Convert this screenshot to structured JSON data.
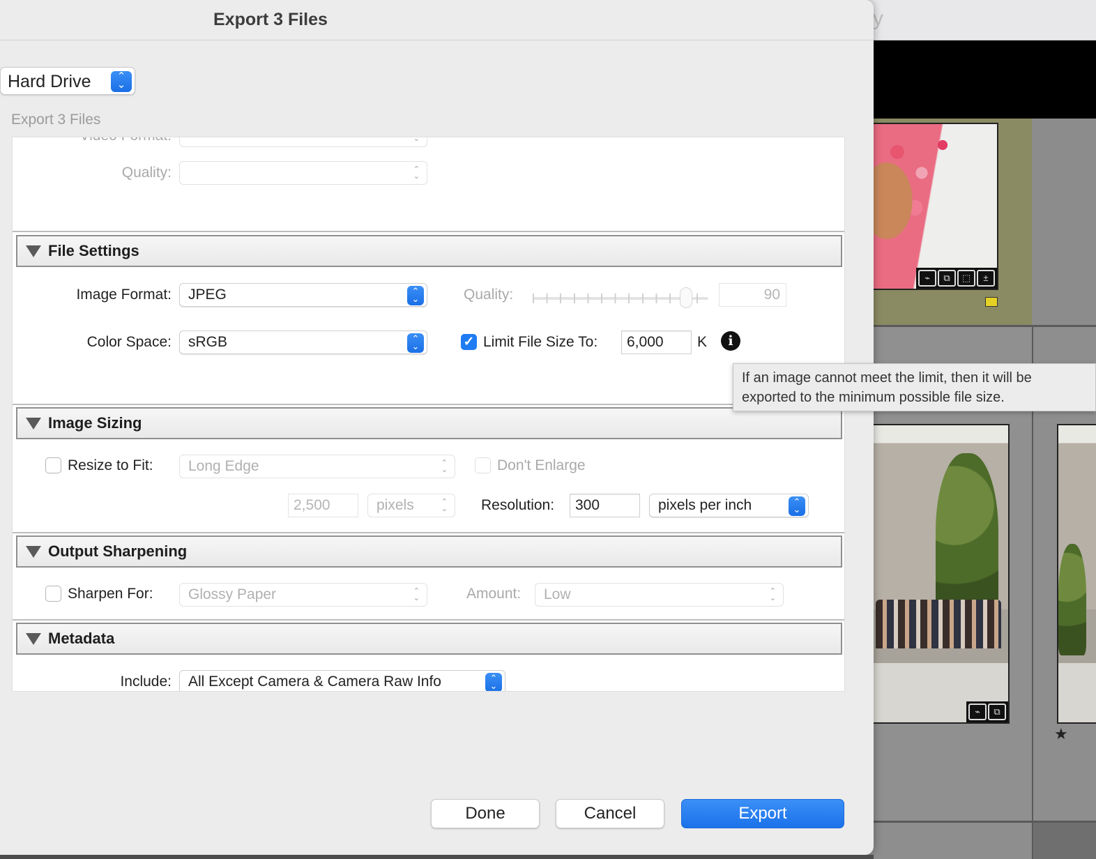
{
  "dialog": {
    "title": "Export 3 Files",
    "destination": "Hard Drive",
    "preset_heading": "Export 3 Files"
  },
  "video": {
    "format_label": "Video Format:",
    "quality_label": "Quality:"
  },
  "file_settings": {
    "heading": "File Settings",
    "image_format_label": "Image Format:",
    "image_format_value": "JPEG",
    "quality_label": "Quality:",
    "quality_value": "90",
    "color_space_label": "Color Space:",
    "color_space_value": "sRGB",
    "limit_checked": true,
    "limit_label": "Limit File Size To:",
    "limit_value": "6,000",
    "limit_unit": "K",
    "tooltip": "If an image cannot meet the limit, then it will be exported to the minimum possible file size."
  },
  "image_sizing": {
    "heading": "Image Sizing",
    "resize_label": "Resize to Fit:",
    "resize_checked": false,
    "resize_mode": "Long Edge",
    "dont_enlarge_label": "Don't Enlarge",
    "size_value": "2,500",
    "size_unit": "pixels",
    "resolution_label": "Resolution:",
    "resolution_value": "300",
    "resolution_unit": "pixels per inch"
  },
  "output_sharpening": {
    "heading": "Output Sharpening",
    "sharpen_label": "Sharpen For:",
    "sharpen_checked": false,
    "sharpen_value": "Glossy Paper",
    "amount_label": "Amount:",
    "amount_value": "Low"
  },
  "metadata": {
    "heading": "Metadata",
    "include_label": "Include:",
    "include_value": "All Except Camera & Camera Raw Info"
  },
  "buttons": {
    "done": "Done",
    "cancel": "Cancel",
    "export": "Export"
  },
  "background": {
    "topbar_glyph": "y",
    "star": "★"
  },
  "colors": {
    "accent": "#1f7cf2",
    "dialog_bg": "#ececec",
    "panel_bg": "#ffffff"
  }
}
